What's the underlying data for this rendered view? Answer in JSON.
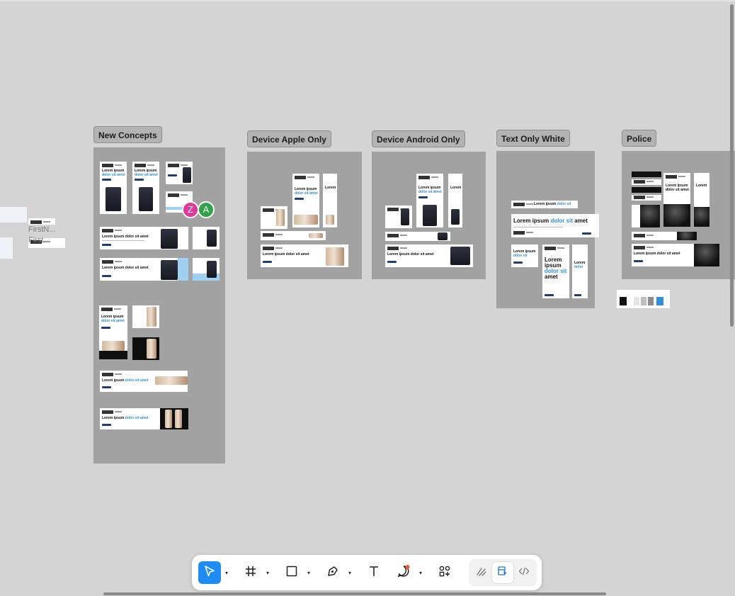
{
  "canvas": {
    "sections": [
      {
        "id": "new-concepts",
        "label": "New Concepts"
      },
      {
        "id": "device-apple-only",
        "label": "Device Apple Only"
      },
      {
        "id": "device-android-only",
        "label": "Device Android Only"
      },
      {
        "id": "text-only-white",
        "label": "Text Only White"
      },
      {
        "id": "police",
        "label": "Police"
      }
    ],
    "ad_headline": "Lorem ipsum",
    "ad_headline_accent": "dolor sit amet",
    "collaborators": [
      {
        "initial": "Z",
        "color": "#e0389a"
      },
      {
        "initial": "A",
        "color": "#2fa24a"
      }
    ],
    "offcanvas_labels": [
      "FirstN...",
      "First"
    ]
  },
  "toolbar": {
    "tools": [
      {
        "name": "move-tool",
        "icon": "cursor-arrow-icon",
        "active": true
      },
      {
        "name": "frame-tool",
        "icon": "hash-frame-icon",
        "active": false
      },
      {
        "name": "rectangle-tool",
        "icon": "square-icon",
        "active": false
      },
      {
        "name": "pen-tool",
        "icon": "pen-nib-icon",
        "active": false
      },
      {
        "name": "text-tool",
        "icon": "text-t-icon",
        "active": false
      },
      {
        "name": "comment-tool",
        "icon": "speech-bubble-icon",
        "active": false
      },
      {
        "name": "resources-tool",
        "icon": "components-icon",
        "active": false
      }
    ],
    "mode": {
      "design": "draw-squiggle-icon",
      "active": "dev-mode-icon",
      "code": "code-brackets-icon"
    },
    "colors": {
      "accent": "#1e8cf0",
      "comment_dot": "#f05a28"
    }
  }
}
